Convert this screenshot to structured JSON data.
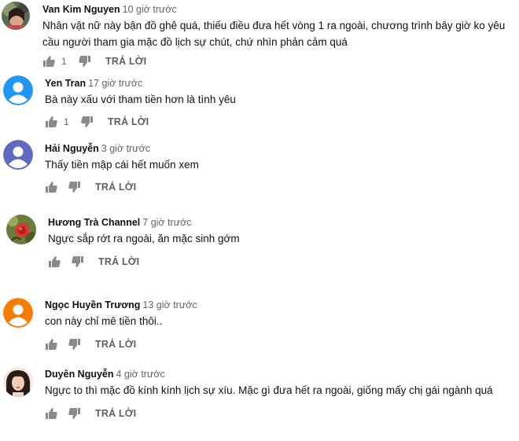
{
  "reply_label": "TRẢ LỜI",
  "comments": [
    {
      "author": "Van Kim Nguyen",
      "time": "10 giờ trước",
      "text": "Nhân vật nữ này bận đồ ghê quá, thiếu điều đưa hết vòng 1 ra ngoài, chương trình bây giờ ko yêu cầu người tham gia mặc đồ lịch sự chút, chứ nhìn phản cảm quá",
      "likes": "1",
      "avatar": "photo"
    },
    {
      "author": "Yen Tran",
      "time": "17 giờ trước",
      "text": "Bà này xấu với tham tiền hơn là tình yêu",
      "likes": "1",
      "avatar": "default",
      "avatar_color": "#2196F3"
    },
    {
      "author": "Hải Nguyễn",
      "time": "3 giờ trước",
      "text": "Thấy tiền mập cái hết muốn xem",
      "likes": "",
      "avatar": "default",
      "avatar_color": "#5C6BC0"
    },
    {
      "author": "Hương Trà Channel",
      "time": "7 giờ trước",
      "text": "Ngực sắp rớt ra ngoài, ăn mặc sinh gớm",
      "likes": "",
      "avatar": "photo-flower"
    },
    {
      "author": "Ngọc Huyền Trương",
      "time": "13 giờ trước",
      "text": "con này chỉ mê tiền thôi..",
      "likes": "",
      "avatar": "default",
      "avatar_color": "#F57C00"
    },
    {
      "author": "Duyên Nguyễn",
      "time": "4 giờ trước",
      "text": "Ngực to thì mặc đồ kính kính lịch sự xíu. Mặc gì đưa hết ra ngoài, giống mấy chị gái ngành quá",
      "likes": "",
      "avatar": "photo-person"
    }
  ]
}
